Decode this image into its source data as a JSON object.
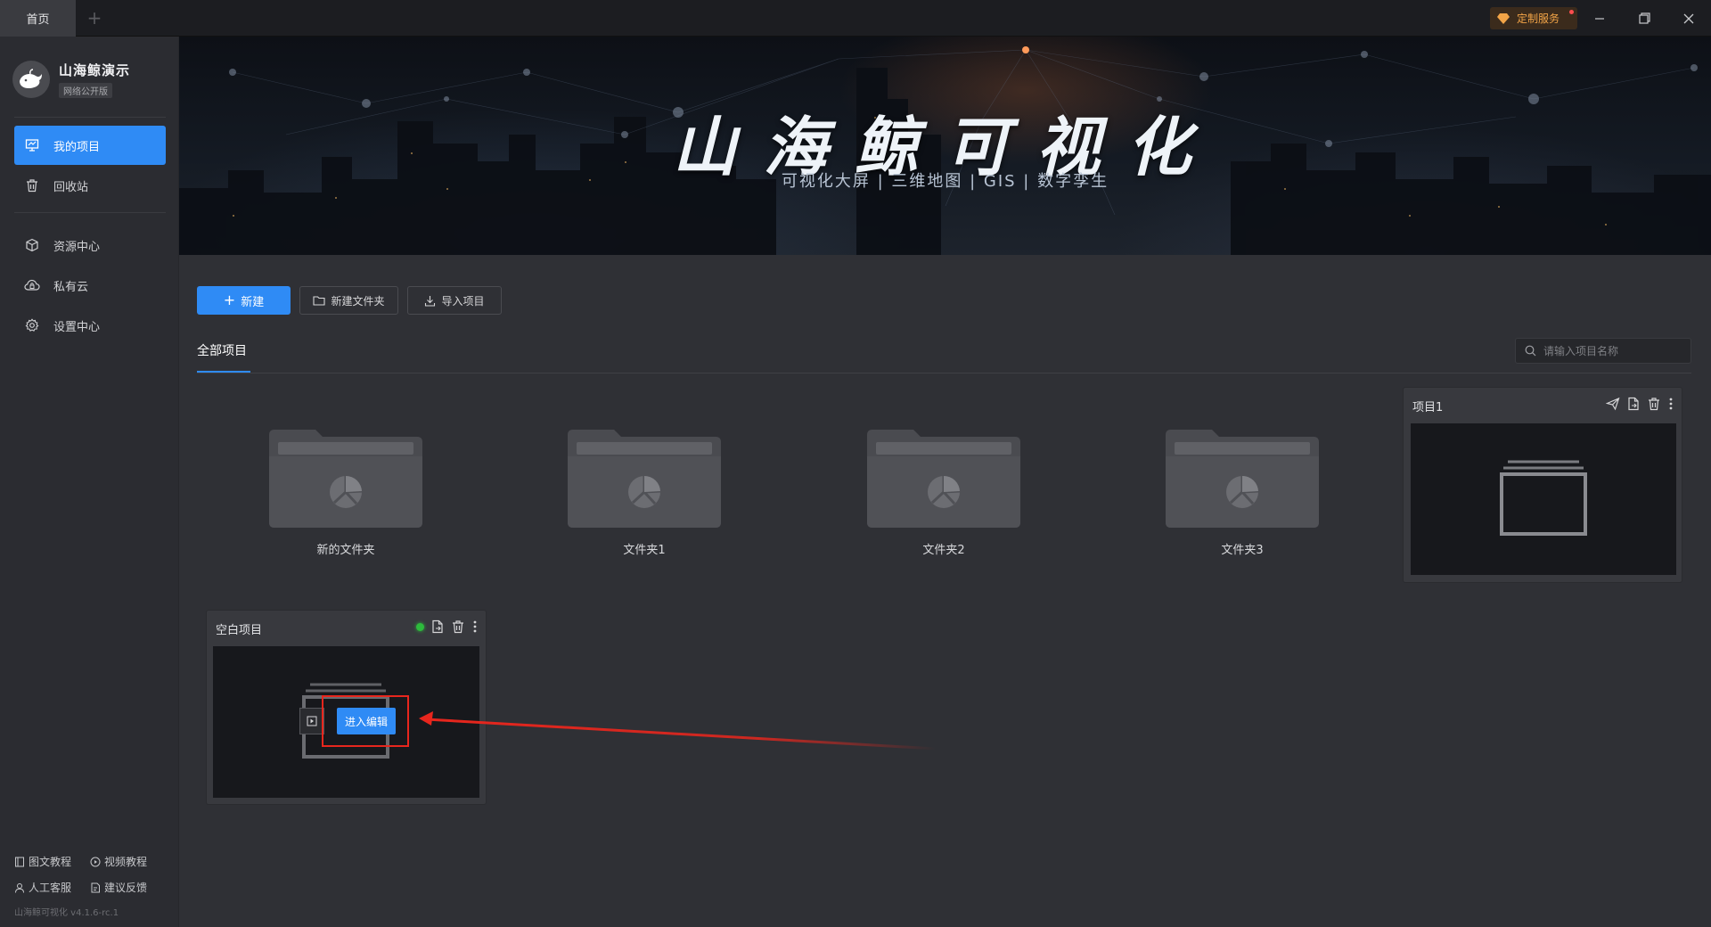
{
  "titlebar": {
    "home_tab": "首页",
    "add_tab": "+",
    "custom_service": "定制服务",
    "icons": [
      "minimize-icon",
      "restore-icon",
      "close-icon"
    ]
  },
  "sidebar": {
    "brand_name": "山海鲸演示",
    "brand_badge": "网络公开版",
    "nav": [
      {
        "label": "我的项目",
        "icon": "project-icon",
        "active": true
      },
      {
        "label": "回收站",
        "icon": "trash-icon",
        "active": false
      },
      {
        "label": "资源中心",
        "icon": "cube-icon",
        "active": false
      },
      {
        "label": "私有云",
        "icon": "cloud-icon",
        "active": false
      },
      {
        "label": "设置中心",
        "icon": "gear-icon",
        "active": false
      }
    ],
    "footer": {
      "doc_tutorial": "图文教程",
      "video_tutorial": "视频教程",
      "support": "人工客服",
      "feedback": "建议反馈",
      "version": "山海鲸可视化 v4.1.6-rc.1"
    }
  },
  "banner": {
    "title": "山海鲸可视化",
    "subtitle": "可视化大屏  |  三维地图  |  GIS  |  数字孪生"
  },
  "toolbar": {
    "new_label": "新建",
    "new_folder_label": "新建文件夹",
    "import_label": "导入项目"
  },
  "tabs": {
    "all_projects": "全部项目"
  },
  "search": {
    "placeholder": "请输入项目名称"
  },
  "folders": [
    {
      "name": "新的文件夹"
    },
    {
      "name": "文件夹1"
    },
    {
      "name": "文件夹2"
    },
    {
      "name": "文件夹3"
    }
  ],
  "projects": [
    {
      "title": "项目1"
    },
    {
      "title": "空白项目",
      "enter_edit_label": "进入编辑",
      "online": true
    }
  ],
  "colors": {
    "accent": "#2f8bf5",
    "annotation": "#e8261d",
    "status_online": "#2dbb3c",
    "service": "#f2a447"
  }
}
